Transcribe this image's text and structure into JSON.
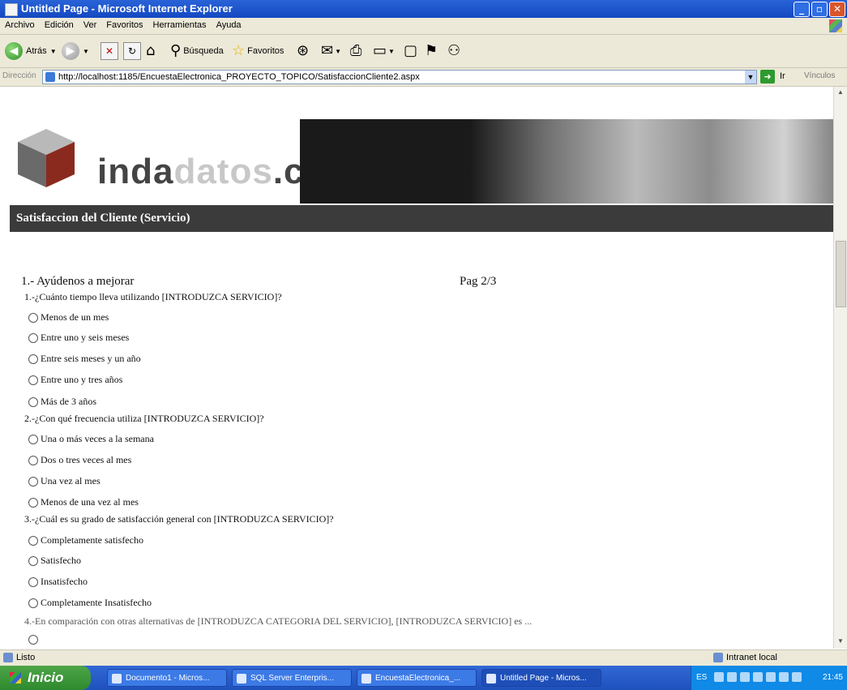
{
  "window": {
    "title": "Untitled Page - Microsoft Internet Explorer"
  },
  "menu": [
    "Archivo",
    "Edición",
    "Ver",
    "Favoritos",
    "Herramientas",
    "Ayuda"
  ],
  "toolbar": {
    "back": "Atrás",
    "search": "Búsqueda",
    "favorites": "Favoritos"
  },
  "address": {
    "label": "Dirección",
    "url": "http://localhost:1185/EncuestaElectronica_PROYECTO_TOPICO/SatisfaccionCliente2.aspx",
    "go": "Ir",
    "links": "Vínculos"
  },
  "page": {
    "logo": {
      "part1": "inda",
      "part2": "datos",
      "part3": ".com"
    },
    "section_title": "Satisfaccion del Cliente (Servicio)",
    "survey_title": "1.- Ayúdenos a mejorar",
    "page_indicator": "Pag 2/3",
    "questions": [
      {
        "text": "1.-¿Cuánto tiempo lleva utilizando [INTRODUZCA SERVICIO]?",
        "options": [
          "Menos de un mes",
          "Entre uno y seis meses",
          "Entre seis meses y un año",
          "Entre uno y tres años",
          "Más de 3 años"
        ]
      },
      {
        "text": "2.-¿Con qué frecuencia utiliza [INTRODUZCA SERVICIO]?",
        "options": [
          "Una o más veces a la semana",
          "Dos o tres veces al mes",
          "Una vez al mes",
          "Menos de una vez al mes"
        ]
      },
      {
        "text": "3.-¿Cuál es su grado de satisfacción general con [INTRODUZCA SERVICIO]?",
        "options": [
          "Completamente satisfecho",
          "Satisfecho",
          "Insatisfecho",
          "Completamente Insatisfecho"
        ]
      },
      {
        "text": "4.-En comparación con otras alternativas de [INTRODUZCA CATEGORIA DEL SERVICIO], [INTRODUZCA SERVICIO] es ...",
        "options": []
      }
    ]
  },
  "status": {
    "left": "Listo",
    "zone": "Intranet local"
  },
  "taskbar": {
    "start": "Inicio",
    "tasks": [
      "Documento1 - Micros...",
      "SQL Server Enterpris...",
      "EncuestaElectronica_...",
      "Untitled Page - Micros..."
    ],
    "lang": "ES",
    "clock": "21:45"
  }
}
